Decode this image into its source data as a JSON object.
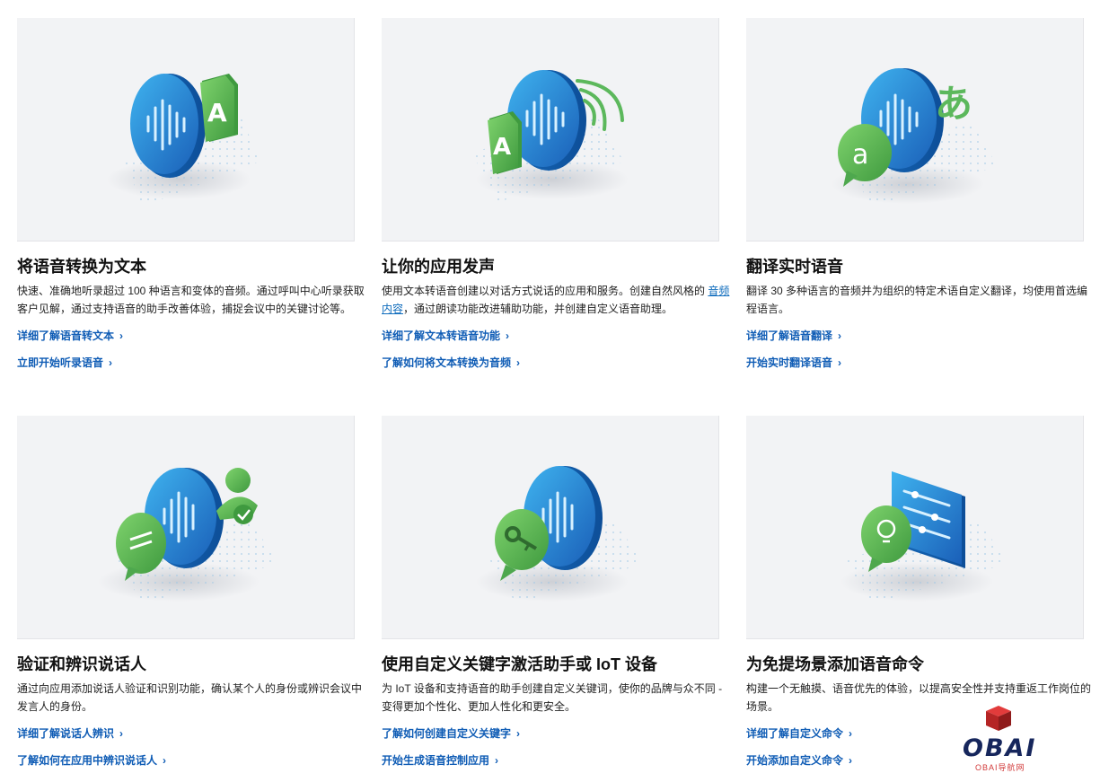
{
  "cards": [
    {
      "title": "将语音转换为文本",
      "desc": "快速、准确地听录超过 100 种语言和变体的音频。通过呼叫中心听录获取客户见解，通过支持语音的助手改善体验，捕捉会议中的关键讨论等。",
      "links": [
        "详细了解语音转文本",
        "立即开始听录语音"
      ],
      "icons": [
        "speech-bubble-icon",
        "document-letter-a-icon"
      ]
    },
    {
      "title": "让你的应用发声",
      "desc_before": "使用文本转语音创建以对话方式说话的应用和服务。创建自然风格的",
      "desc_link": "音频内容",
      "desc_after": "，通过朗读功能改进辅助功能，并创建自定义语音助理。",
      "links": [
        "详细了解文本转语音功能",
        "了解如何将文本转换为音频"
      ],
      "icons": [
        "speech-bubble-icon",
        "sound-wave-icon",
        "document-letter-a-icon"
      ]
    },
    {
      "title": "翻译实时语音",
      "desc": "翻译 30 多种语言的音频并为组织的特定术语自定义翻译，均使用首选编程语言。",
      "links": [
        "详细了解语音翻译",
        "开始实时翻译语音"
      ],
      "icons": [
        "speech-bubble-icon",
        "translation-character-icon",
        "chat-letter-a-icon"
      ]
    },
    {
      "title": "验证和辨识说话人",
      "desc": "通过向应用添加说话人验证和识别功能，确认某个人的身份或辨识会议中发言人的身份。",
      "links": [
        "详细了解说话人辨识",
        "了解如何在应用中辨识说话人"
      ],
      "icons": [
        "speech-bubble-icon",
        "chat-icon",
        "verified-user-icon"
      ]
    },
    {
      "title": "使用自定义关键字激活助手或 IoT 设备",
      "desc": "为 IoT 设备和支持语音的助手创建自定义关键词，使你的品牌与众不同 - 变得更加个性化、更加人性化和更安全。",
      "links": [
        "了解如何创建自定义关键字",
        "开始生成语音控制应用"
      ],
      "icons": [
        "speech-bubble-icon",
        "key-icon"
      ]
    },
    {
      "title": "为免提场景添加语音命令",
      "desc": "构建一个无触摸、语音优先的体验，以提高安全性并支持重返工作岗位的场景。",
      "links": [
        "详细了解自定义命令",
        "开始添加自定义命令"
      ],
      "icons": [
        "lightbulb-icon",
        "settings-panel-icon"
      ]
    }
  ],
  "chevron": "›",
  "watermark": {
    "logo": "OBAI",
    "sub": "OBAI导航网"
  },
  "colors": {
    "accent": "#0f5cb5",
    "blue": "#1a73c9",
    "green": "#5cb85c",
    "bg": "#f2f3f5"
  }
}
